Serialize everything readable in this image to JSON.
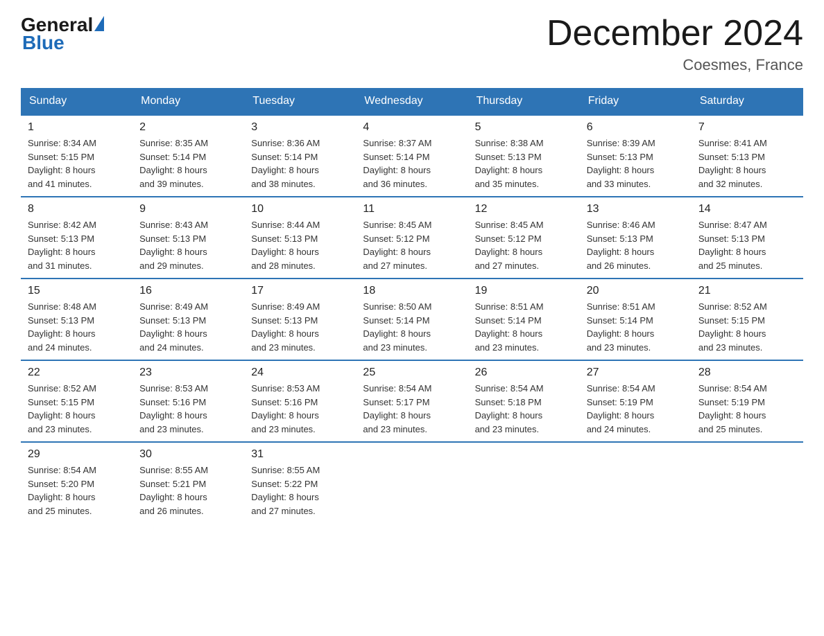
{
  "header": {
    "logo_general": "General",
    "logo_blue": "Blue",
    "title": "December 2024",
    "subtitle": "Coesmes, France"
  },
  "days_of_week": [
    "Sunday",
    "Monday",
    "Tuesday",
    "Wednesday",
    "Thursday",
    "Friday",
    "Saturday"
  ],
  "weeks": [
    [
      {
        "day": "1",
        "info": "Sunrise: 8:34 AM\nSunset: 5:15 PM\nDaylight: 8 hours\nand 41 minutes."
      },
      {
        "day": "2",
        "info": "Sunrise: 8:35 AM\nSunset: 5:14 PM\nDaylight: 8 hours\nand 39 minutes."
      },
      {
        "day": "3",
        "info": "Sunrise: 8:36 AM\nSunset: 5:14 PM\nDaylight: 8 hours\nand 38 minutes."
      },
      {
        "day": "4",
        "info": "Sunrise: 8:37 AM\nSunset: 5:14 PM\nDaylight: 8 hours\nand 36 minutes."
      },
      {
        "day": "5",
        "info": "Sunrise: 8:38 AM\nSunset: 5:13 PM\nDaylight: 8 hours\nand 35 minutes."
      },
      {
        "day": "6",
        "info": "Sunrise: 8:39 AM\nSunset: 5:13 PM\nDaylight: 8 hours\nand 33 minutes."
      },
      {
        "day": "7",
        "info": "Sunrise: 8:41 AM\nSunset: 5:13 PM\nDaylight: 8 hours\nand 32 minutes."
      }
    ],
    [
      {
        "day": "8",
        "info": "Sunrise: 8:42 AM\nSunset: 5:13 PM\nDaylight: 8 hours\nand 31 minutes."
      },
      {
        "day": "9",
        "info": "Sunrise: 8:43 AM\nSunset: 5:13 PM\nDaylight: 8 hours\nand 29 minutes."
      },
      {
        "day": "10",
        "info": "Sunrise: 8:44 AM\nSunset: 5:13 PM\nDaylight: 8 hours\nand 28 minutes."
      },
      {
        "day": "11",
        "info": "Sunrise: 8:45 AM\nSunset: 5:12 PM\nDaylight: 8 hours\nand 27 minutes."
      },
      {
        "day": "12",
        "info": "Sunrise: 8:45 AM\nSunset: 5:12 PM\nDaylight: 8 hours\nand 27 minutes."
      },
      {
        "day": "13",
        "info": "Sunrise: 8:46 AM\nSunset: 5:13 PM\nDaylight: 8 hours\nand 26 minutes."
      },
      {
        "day": "14",
        "info": "Sunrise: 8:47 AM\nSunset: 5:13 PM\nDaylight: 8 hours\nand 25 minutes."
      }
    ],
    [
      {
        "day": "15",
        "info": "Sunrise: 8:48 AM\nSunset: 5:13 PM\nDaylight: 8 hours\nand 24 minutes."
      },
      {
        "day": "16",
        "info": "Sunrise: 8:49 AM\nSunset: 5:13 PM\nDaylight: 8 hours\nand 24 minutes."
      },
      {
        "day": "17",
        "info": "Sunrise: 8:49 AM\nSunset: 5:13 PM\nDaylight: 8 hours\nand 23 minutes."
      },
      {
        "day": "18",
        "info": "Sunrise: 8:50 AM\nSunset: 5:14 PM\nDaylight: 8 hours\nand 23 minutes."
      },
      {
        "day": "19",
        "info": "Sunrise: 8:51 AM\nSunset: 5:14 PM\nDaylight: 8 hours\nand 23 minutes."
      },
      {
        "day": "20",
        "info": "Sunrise: 8:51 AM\nSunset: 5:14 PM\nDaylight: 8 hours\nand 23 minutes."
      },
      {
        "day": "21",
        "info": "Sunrise: 8:52 AM\nSunset: 5:15 PM\nDaylight: 8 hours\nand 23 minutes."
      }
    ],
    [
      {
        "day": "22",
        "info": "Sunrise: 8:52 AM\nSunset: 5:15 PM\nDaylight: 8 hours\nand 23 minutes."
      },
      {
        "day": "23",
        "info": "Sunrise: 8:53 AM\nSunset: 5:16 PM\nDaylight: 8 hours\nand 23 minutes."
      },
      {
        "day": "24",
        "info": "Sunrise: 8:53 AM\nSunset: 5:16 PM\nDaylight: 8 hours\nand 23 minutes."
      },
      {
        "day": "25",
        "info": "Sunrise: 8:54 AM\nSunset: 5:17 PM\nDaylight: 8 hours\nand 23 minutes."
      },
      {
        "day": "26",
        "info": "Sunrise: 8:54 AM\nSunset: 5:18 PM\nDaylight: 8 hours\nand 23 minutes."
      },
      {
        "day": "27",
        "info": "Sunrise: 8:54 AM\nSunset: 5:19 PM\nDaylight: 8 hours\nand 24 minutes."
      },
      {
        "day": "28",
        "info": "Sunrise: 8:54 AM\nSunset: 5:19 PM\nDaylight: 8 hours\nand 25 minutes."
      }
    ],
    [
      {
        "day": "29",
        "info": "Sunrise: 8:54 AM\nSunset: 5:20 PM\nDaylight: 8 hours\nand 25 minutes."
      },
      {
        "day": "30",
        "info": "Sunrise: 8:55 AM\nSunset: 5:21 PM\nDaylight: 8 hours\nand 26 minutes."
      },
      {
        "day": "31",
        "info": "Sunrise: 8:55 AM\nSunset: 5:22 PM\nDaylight: 8 hours\nand 27 minutes."
      },
      {
        "day": "",
        "info": ""
      },
      {
        "day": "",
        "info": ""
      },
      {
        "day": "",
        "info": ""
      },
      {
        "day": "",
        "info": ""
      }
    ]
  ]
}
